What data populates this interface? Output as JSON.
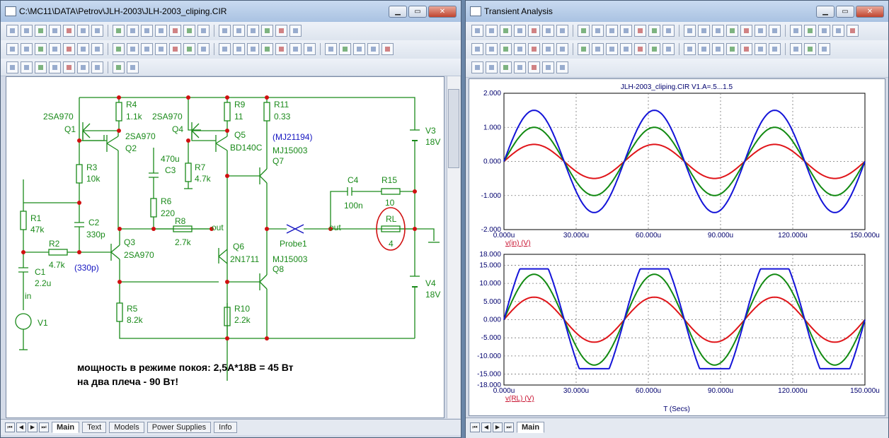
{
  "schematic_window": {
    "title": "C:\\MC11\\DATA\\Petrov\\JLH-2003\\JLH-2003_cliping.CIR",
    "tabs": [
      "Main",
      "Text",
      "Models",
      "Power Supplies",
      "Info"
    ],
    "active_tab": "Main",
    "components": {
      "q1_model": "2SA970",
      "q1_ref": "Q1",
      "q2_model": "2SA970",
      "q2_ref": "Q2",
      "r4_ref": "R4",
      "r4_val": "1.1k",
      "q4_model": "2SA970",
      "q4_ref": "Q4",
      "r9_ref": "R9",
      "r9_val": "11",
      "r11_ref": "R11",
      "r11_val": "0.33",
      "q5_ref": "Q5",
      "q5_model": "BD140C",
      "q7_alt": "(MJ21194)",
      "q7_model": "MJ15003",
      "q7_ref": "Q7",
      "v3_ref": "V3",
      "v3_val": "18V",
      "c3_val": "470u",
      "c3_ref": "C3",
      "r3_ref": "R3",
      "r3_val": "10k",
      "r7_ref": "R7",
      "r7_val": "4.7k",
      "r6_ref": "R6",
      "r6_val": "220",
      "c2_ref": "C2",
      "c2_val": "330p",
      "r1_ref": "R1",
      "r1_val": "47k",
      "r8_ref": "R8",
      "r8_val": "2.7k",
      "out1": "out",
      "c4_ref": "C4",
      "c4_val": "100n",
      "r15_ref": "R15",
      "r15_val": "10",
      "rl_ref": "RL",
      "rl_val": "4",
      "probe": "Probe1",
      "out2": "out",
      "q3_ref": "Q3",
      "q3_model": "2SA970",
      "r2_ref": "R2",
      "r2_val": "4.7k",
      "c2b": "(330p)",
      "q6_ref": "Q6",
      "q6_model": "2N1711",
      "q8_model": "MJ15003",
      "q8_ref": "Q8",
      "c1_ref": "C1",
      "c1_val": "2.2u",
      "in_label": "in",
      "v4_ref": "V4",
      "v4_val": "18V",
      "r5_ref": "R5",
      "r5_val": "8.2k",
      "r10_ref": "R10",
      "r10_val": "2.2k",
      "v1_ref": "V1"
    },
    "note_line1": "мощность в режиме покоя: 2,5А*18В = 45 Вт",
    "note_line2": "на два плеча - 90 Вт!"
  },
  "analysis_window": {
    "title": "Transient Analysis",
    "tabs": [
      "Main"
    ],
    "active_tab": "Main",
    "plot_title": "JLH-2003_cliping.CIR V1.A=.5...1.5",
    "x_axis_label": "T (Secs)",
    "colors": {
      "red": "#e0151a",
      "green": "#128a12",
      "blue": "#1414d8",
      "axis_text": "#00006e"
    }
  },
  "chart_data": [
    {
      "type": "line",
      "ylabel": "v(in) (V)",
      "x_ticks": [
        "0.000u",
        "30.000u",
        "60.000u",
        "90.000u",
        "120.000u",
        "150.000u"
      ],
      "y_ticks": [
        "2.000",
        "1.000",
        "0.000",
        "-1.000",
        "-2.000"
      ],
      "xlim": [
        0,
        150
      ],
      "ylim": [
        -2,
        2
      ],
      "grid": true,
      "series": [
        {
          "color": "#e0151a",
          "amplitude": 0.5,
          "period_us": 50
        },
        {
          "color": "#128a12",
          "amplitude": 1.0,
          "period_us": 50
        },
        {
          "color": "#1414d8",
          "amplitude": 1.5,
          "period_us": 50
        }
      ]
    },
    {
      "type": "line",
      "ylabel": "v(RL) (V)",
      "x_ticks": [
        "0.000u",
        "30.000u",
        "60.000u",
        "90.000u",
        "120.000u",
        "150.000u"
      ],
      "y_ticks": [
        "18.000",
        "15.000",
        "10.000",
        "5.000",
        "0.000",
        "-5.000",
        "-10.000",
        "-15.000",
        "-18.000"
      ],
      "xlim": [
        0,
        150
      ],
      "ylim": [
        -18,
        18
      ],
      "grid": true,
      "series": [
        {
          "color": "#e0151a",
          "amplitude": 6.2,
          "period_us": 50,
          "clip_high": 18,
          "clip_low": -18
        },
        {
          "color": "#128a12",
          "amplitude": 12.5,
          "period_us": 50,
          "clip_high": 18,
          "clip_low": -18
        },
        {
          "color": "#1414d8",
          "amplitude": 19.0,
          "period_us": 50,
          "clip_high": 14.0,
          "clip_low": -13.5
        }
      ]
    }
  ]
}
